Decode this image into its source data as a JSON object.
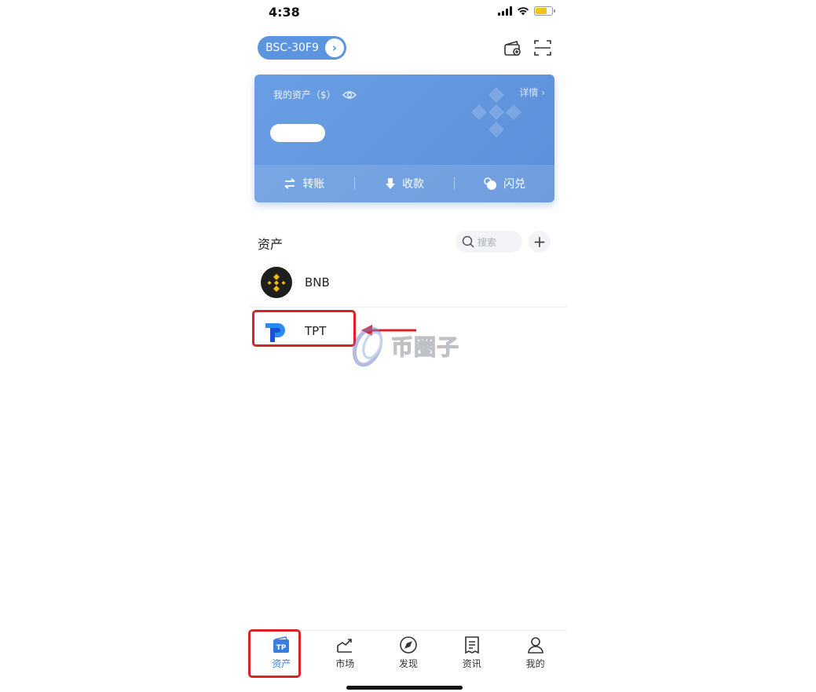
{
  "status_bar": {
    "time": "4:38"
  },
  "header": {
    "wallet_name": "BSC-30F9",
    "wallet_arrow": "›",
    "icons": [
      "wallet-add-icon",
      "scan-icon"
    ]
  },
  "card": {
    "title": "我的资产（$）",
    "detail_label": "详情 ›",
    "balance_hidden": true,
    "actions": [
      {
        "label": "转账",
        "icon": "transfer-icon"
      },
      {
        "label": "收款",
        "icon": "receive-icon"
      },
      {
        "label": "闪兑",
        "icon": "swap-icon"
      }
    ]
  },
  "assets": {
    "title": "资产",
    "search_placeholder": "搜索",
    "add_label": "+",
    "tokens": [
      {
        "name": "BNB",
        "icon": "bnb-logo-icon"
      },
      {
        "name": "TPT",
        "icon": "tpt-logo-icon"
      }
    ]
  },
  "watermark": {
    "text": "币圈子"
  },
  "colors": {
    "accent": "#5b95e0",
    "highlight": "#d9232b",
    "active_tab": "#3b7de0"
  },
  "tabbar": {
    "active": "资产",
    "tabs": [
      {
        "label": "资产",
        "icon": "tp-wallet-icon"
      },
      {
        "label": "市场",
        "icon": "market-chart-icon"
      },
      {
        "label": "发现",
        "icon": "compass-icon"
      },
      {
        "label": "资讯",
        "icon": "news-icon"
      },
      {
        "label": "我的",
        "icon": "user-icon"
      }
    ]
  }
}
